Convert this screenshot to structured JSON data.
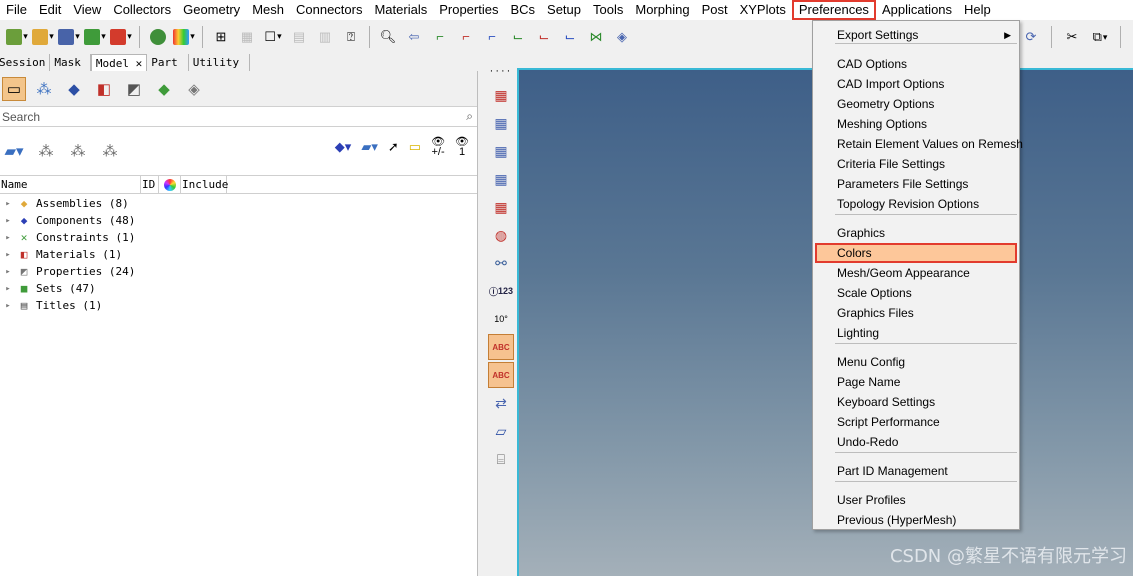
{
  "menubar": {
    "items": [
      "File",
      "Edit",
      "View",
      "Collectors",
      "Geometry",
      "Mesh",
      "Connectors",
      "Materials",
      "Properties",
      "BCs",
      "Setup",
      "Tools",
      "Morphing",
      "Post",
      "XYPlots",
      "Preferences",
      "Applications",
      "Help"
    ],
    "active": "Preferences"
  },
  "toolbar": {
    "icons": [
      "open-model-icon",
      "import-icon",
      "save-icon",
      "export-icon",
      "export-ppt-icon",
      "user-profile-icon",
      "model-colors-icon",
      "add-panel-icon",
      "blank-panel-icon",
      "window-icon",
      "split-view-icon",
      "page-view-icon",
      "question-icon",
      "zoom-icon",
      "back-arrow-icon",
      "view-x-icon",
      "view-y-icon",
      "view-z-icon",
      "view-nx-icon",
      "view-ny-icon",
      "view-nz-icon",
      "isometric-icon"
    ]
  },
  "left_panel": {
    "tabs": [
      "Session",
      "Mask",
      "Model",
      "Part",
      "Utility"
    ],
    "selected_tab": "Model",
    "search_placeholder": "Search",
    "columns": [
      "Name",
      "ID",
      "Include"
    ],
    "tree": [
      {
        "label": "Assemblies (8)"
      },
      {
        "label": "Components (48)"
      },
      {
        "label": "Constraints (1)"
      },
      {
        "label": "Materials (1)"
      },
      {
        "label": "Properties (24)"
      },
      {
        "label": "Sets (47)"
      },
      {
        "label": "Titles (1)"
      }
    ],
    "eye_labels": [
      "+/-",
      "1"
    ]
  },
  "vertical_toolbar": {
    "labels": [
      "123",
      "10°",
      "ABC",
      "ABC"
    ]
  },
  "preferences_menu": {
    "groups": [
      [
        {
          "label": "Export Settings",
          "submenu": true
        }
      ],
      [
        {
          "label": "CAD Options"
        },
        {
          "label": "CAD Import Options"
        },
        {
          "label": "Geometry Options"
        },
        {
          "label": "Meshing Options"
        },
        {
          "label": "Retain Element Values on Remesh"
        },
        {
          "label": "Criteria File Settings"
        },
        {
          "label": "Parameters File Settings"
        },
        {
          "label": "Topology Revision Options"
        }
      ],
      [
        {
          "label": "Graphics"
        },
        {
          "label": "Colors",
          "highlighted": true
        },
        {
          "label": "Mesh/Geom Appearance"
        },
        {
          "label": "Scale Options"
        },
        {
          "label": "Graphics Files"
        },
        {
          "label": "Lighting"
        }
      ],
      [
        {
          "label": "Menu Config"
        },
        {
          "label": "Page Name"
        },
        {
          "label": "Keyboard Settings"
        },
        {
          "label": "Script Performance"
        },
        {
          "label": "Undo-Redo"
        }
      ],
      [
        {
          "label": "Part ID Management"
        }
      ],
      [
        {
          "label": "User Profiles"
        },
        {
          "label": "Previous (HyperMesh)"
        }
      ]
    ]
  },
  "watermark": "CSDN @繁星不语有限元学习",
  "colors": {
    "highlight": "#fdc79a",
    "highlight_border": "#e23b2e",
    "viewport_top": "#3e5f88",
    "viewport_bottom": "#a4b0b9"
  }
}
